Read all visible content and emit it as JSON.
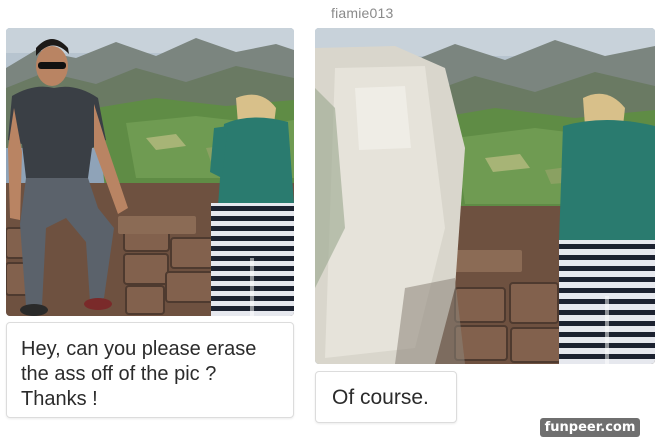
{
  "post": {
    "username": "fiamie013"
  },
  "request": {
    "message_line1": "Hey, can you please erase",
    "message_line2": "the ass off of the pic ?",
    "message_line3": "Thanks !"
  },
  "reply": {
    "message": "Of course."
  },
  "watermark": {
    "text": "funpeer.com"
  },
  "colors": {
    "sky": "#a9b9c9",
    "mountains": "#6f7a72",
    "valley": "#5f8a4a",
    "wall_stone": "#7a5a45",
    "jacket": "#2a7b6f",
    "stripes_dark": "#1c2230",
    "stripes_light": "#e6e8ee",
    "erased_patch": "#d9d6cc"
  }
}
